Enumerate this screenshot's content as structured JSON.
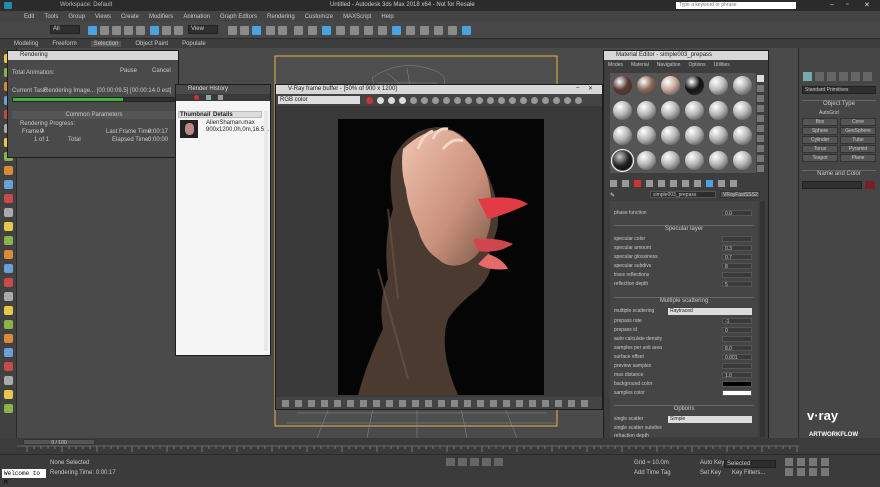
{
  "app": {
    "workspace": "Workspace: Default",
    "title": "Untitled - Autodesk 3ds Max 2018 x64 - Not for Resale",
    "search_placeholder": "Type a keyword or phrase"
  },
  "menu": [
    "Edit",
    "Tools",
    "Group",
    "Views",
    "Create",
    "Modifiers",
    "Animation",
    "Graph Editors",
    "Rendering",
    "Customize",
    "MAXScript",
    "Help"
  ],
  "ribbon": [
    "Modeling",
    "Freeform",
    "Selection",
    "Object Paint",
    "Populate"
  ],
  "toolbar": {
    "view_select": "All",
    "ref_coord": "View"
  },
  "rendering_dialog": {
    "title": "Rendering",
    "pause": "Pause",
    "cancel": "Cancel",
    "total_animation": "Total Animation:",
    "current_task_label": "Current Task:",
    "current_task": "Rendering Image... [00:00:09.5] [00:00:14.0 est]",
    "common_params": "Common Parameters",
    "rendering_progress": "Rendering Progress:",
    "frame_label": "Frame #",
    "frame_value": "0",
    "of_label": "1 of 1",
    "total_label": "Total",
    "last_frame_label": "Last Frame Time:",
    "last_frame_value": "0:00:17",
    "elapsed_label": "Elapsed Time:",
    "elapsed_value": "0:00:00"
  },
  "render_history": {
    "title": "Render History",
    "col_thumb": "Thumbnail",
    "col_details": "Details",
    "item_name": "AlienShaman.max",
    "item_info": "900x1200,0h,0m,16.5..."
  },
  "vfb": {
    "title": "V-Ray frame buffer - [50% of 900 x 1200]",
    "channel": "RGB color"
  },
  "material_editor": {
    "title": "Material Editor - simple003_prepass",
    "menus": [
      "Modes",
      "Material",
      "Navigation",
      "Options",
      "Utilities"
    ],
    "mat_name": "simple003_prepass",
    "mat_type": "VRayFastSSS2",
    "phase_function_label": "phase function",
    "phase_function_value": "0.0",
    "specular_section": "Specular layer",
    "specular_rows": [
      {
        "label": "specular color",
        "value": ""
      },
      {
        "label": "specular amount",
        "value": "0.3"
      },
      {
        "label": "specular glossiness",
        "value": "0.7"
      },
      {
        "label": "specular subdivs",
        "value": "8"
      },
      {
        "label": "trace reflections",
        "value": ""
      },
      {
        "label": "reflection depth",
        "value": "5"
      }
    ],
    "scatter_section": "Multiple scattering",
    "multiple_scattering_label": "multiple scattering",
    "multiple_scattering_value": "Raytraced",
    "scatter_rows": [
      {
        "label": "prepass rate",
        "value": "-1"
      },
      {
        "label": "prepass id",
        "value": "0"
      },
      {
        "label": "auto calculate density",
        "value": ""
      },
      {
        "label": "samples per unit area",
        "value": "8.0"
      },
      {
        "label": "surface offset",
        "value": "0.001"
      },
      {
        "label": "preview samples",
        "value": ""
      },
      {
        "label": "max distance",
        "value": "1.0"
      },
      {
        "label": "background color",
        "value": ""
      },
      {
        "label": "samples color",
        "value": ""
      }
    ],
    "options_section": "Options",
    "single_scatter_label": "single scatter",
    "single_scatter_value": "Simple",
    "single_scatter_subdivs": "single scatter subdivs",
    "refraction_depth": "refraction depth"
  },
  "command_panel": {
    "dropdown": "Standard Primitives",
    "object_type": "Object Type",
    "autogrid": "AutoGrid",
    "buttons": [
      "Box",
      "Cone",
      "Sphere",
      "GeoSphere",
      "Cylinder",
      "Tube",
      "Torus",
      "Pyramid",
      "Teapot",
      "Plane"
    ],
    "name_color": "Name and Color"
  },
  "timeline": {
    "frame_counter": "0 / 100"
  },
  "status": {
    "maxscript": "Welcome to M",
    "none_selected": "None Selected",
    "rendering_time": "Rendering Time: 0:00:17",
    "grid": "Grid = 10.0m",
    "add_time_tag": "Add Time Tag",
    "auto_key": "Auto Key",
    "set_key": "Set Key",
    "key_filters": "Key Filters...",
    "selected": "Selected"
  },
  "brand": {
    "vray": "v·ray",
    "artworkflow": "ARTWORKFLOW"
  },
  "colors": {
    "accent": "#4aa3df",
    "progress": "#3cb43c",
    "dark_bg": "#3c3c3c"
  }
}
